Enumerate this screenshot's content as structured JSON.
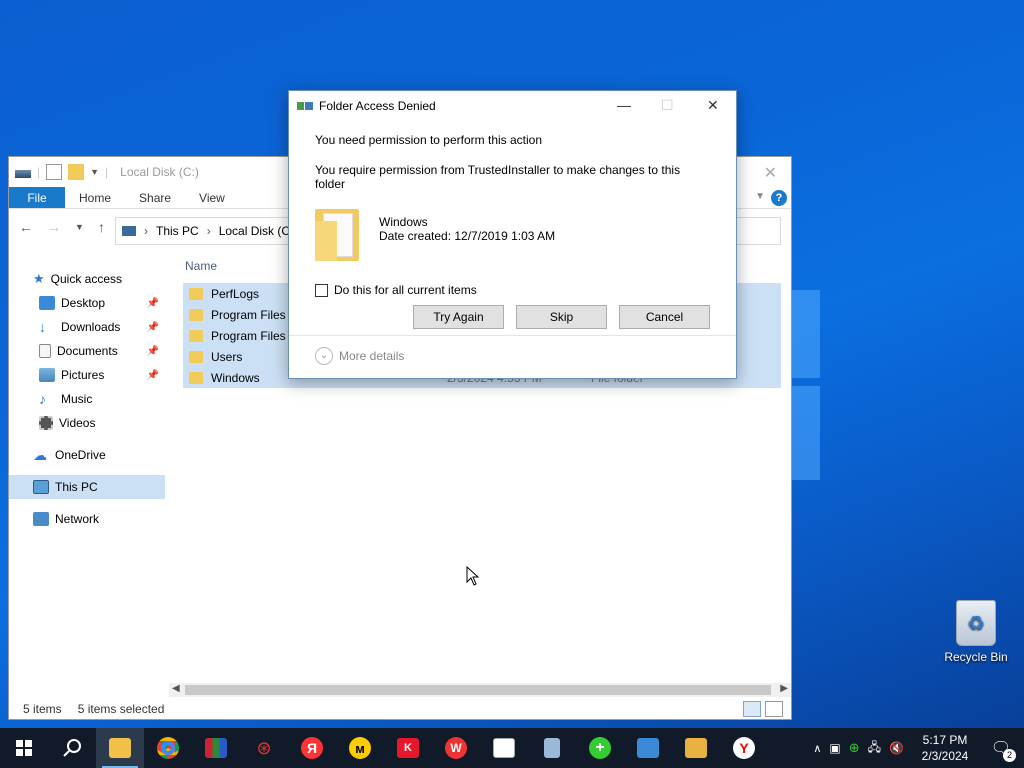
{
  "desktop": {
    "recycle_bin_label": "Recycle Bin"
  },
  "explorer": {
    "title": "Local Disk (C:)",
    "ribbon_tabs": [
      "File",
      "Home",
      "Share",
      "View"
    ],
    "help_label": "?",
    "address": {
      "crumbs": [
        "This PC",
        "Local Disk (C:)"
      ]
    },
    "sidebar": {
      "quick_access": "Quick access",
      "items": [
        "Desktop",
        "Downloads",
        "Documents",
        "Pictures",
        "Music",
        "Videos"
      ],
      "onedrive": "OneDrive",
      "this_pc": "This PC",
      "network": "Network"
    },
    "column_name": "Name",
    "rows": [
      {
        "name": "PerfLogs",
        "date": "",
        "type": ""
      },
      {
        "name": "Program Files",
        "date": "",
        "type": ""
      },
      {
        "name": "Program Files (x86)",
        "date": "",
        "type": ""
      },
      {
        "name": "Users",
        "date": "",
        "type": ""
      },
      {
        "name": "Windows",
        "date": "2/3/2024 4:53 PM",
        "type": "File folder"
      }
    ],
    "status": {
      "items": "5 items",
      "selected": "5 items selected"
    }
  },
  "dialog": {
    "title": "Folder Access Denied",
    "message1": "You need permission to perform this action",
    "message2": "You require permission from TrustedInstaller to make changes to this folder",
    "folder_name": "Windows",
    "date_created": "Date created: 12/7/2019 1:03 AM",
    "checkbox_label": "Do this for all current items",
    "buttons": {
      "try_again": "Try Again",
      "skip": "Skip",
      "cancel": "Cancel"
    },
    "more_details": "More details"
  },
  "taskbar": {
    "time": "5:17 PM",
    "date": "2/3/2024",
    "notification_count": "2"
  },
  "colors": {
    "desktop_blue": "#0a66d6",
    "selection": "#cce0f5",
    "file_tab": "#1979ca",
    "taskbar": "#101a28"
  }
}
